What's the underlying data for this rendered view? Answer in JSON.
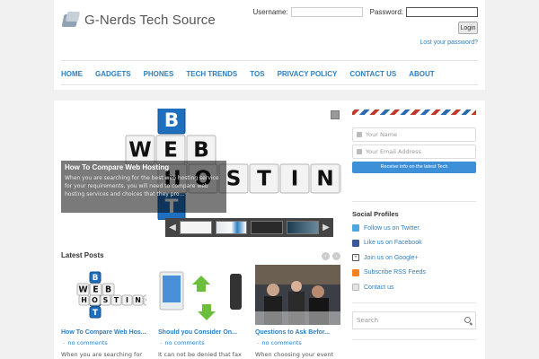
{
  "site": {
    "title": "G-Nerds Tech Source"
  },
  "login": {
    "username_label": "Username:",
    "password_label": "Password:",
    "button": "Login",
    "lost_password": "Lost your password?"
  },
  "nav": {
    "items": [
      "HOME",
      "GADGETS",
      "PHONES",
      "TECH TRENDS",
      "TOS",
      "PRIVACY POLICY",
      "CONTACT US",
      "ABOUT"
    ]
  },
  "slider": {
    "headline": "How To Compare Web Hosting",
    "excerpt": "When you are searching for the best web hosting service for your requirements, you will need to compare web hosting services and choices that they pro...",
    "art": {
      "col_letters": [
        "B",
        "E",
        "S",
        "T"
      ],
      "word1": [
        "W",
        "E",
        "B"
      ],
      "word2": [
        "H",
        "O",
        "S",
        "T",
        "I",
        "N",
        "G"
      ]
    }
  },
  "latest": {
    "title": "Latest Posts",
    "posts": [
      {
        "title": "How To Compare Web Hos...",
        "meta": "no comments",
        "excerpt": "When you are searching for"
      },
      {
        "title": "Should you Consider On...",
        "meta": "no comments",
        "excerpt": "It can not be denied that fax"
      },
      {
        "title": "Questions to Ask Befor...",
        "meta": "no comments",
        "excerpt": "When choosing your event"
      }
    ]
  },
  "subscribe": {
    "name_placeholder": "Your Name",
    "email_placeholder": "Your Email Address",
    "button": "Receive info on the latest Tech"
  },
  "social": {
    "title": "Social Profiles",
    "items": [
      {
        "label": "Follow us on Twitter.",
        "icon": "twitter-icon",
        "color": "#4da7de"
      },
      {
        "label": "Like us on Facebook",
        "icon": "facebook-icon",
        "color": "#3b5998"
      },
      {
        "label": "Join us on Google+",
        "icon": "google-plus-icon",
        "color": "#555555"
      },
      {
        "label": "Subscribe RSS Feeds",
        "icon": "rss-icon",
        "color": "#f58220"
      },
      {
        "label": "Contact us",
        "icon": "mail-icon",
        "color": "#bbbbbb"
      }
    ]
  },
  "search": {
    "placeholder": "Search"
  },
  "colors": {
    "link": "#2d7fc1",
    "accent_button": "#3d8fd8"
  }
}
